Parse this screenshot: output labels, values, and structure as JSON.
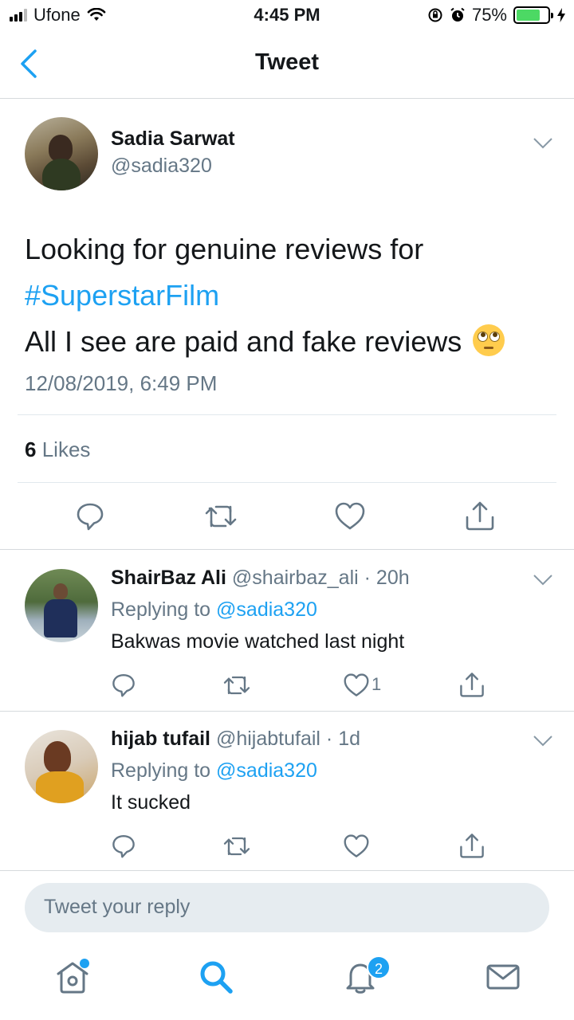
{
  "status_bar": {
    "carrier": "Ufone",
    "time": "4:45 PM",
    "battery": "75%",
    "battery_level": 0.75,
    "icons": [
      "signal-icon",
      "wifi-icon",
      "orientation-lock-icon",
      "alarm-icon",
      "battery-icon",
      "charging-icon"
    ]
  },
  "header": {
    "title": "Tweet",
    "back_icon": "chevron-left-icon"
  },
  "tweet": {
    "author_name": "Sadia Sarwat",
    "author_handle": "@sadia320",
    "text_line1": "Looking for genuine reviews for",
    "hashtag": "#SuperstarFilm",
    "text_line3": "All I see are paid and fake reviews",
    "emoji": "face-with-rolling-eyes",
    "timestamp": "12/08/2019, 6:49 PM",
    "likes_count": "6",
    "likes_label": "Likes"
  },
  "replies": [
    {
      "name": "ShairBaz Ali",
      "handle": "@shairbaz_ali",
      "time": "· 20h",
      "replying_label": "Replying to",
      "replying_to": "@sadia320",
      "text": "Bakwas movie watched last night",
      "like_count": "1"
    },
    {
      "name": "hijab tufail",
      "handle": "@hijabtufail",
      "time": "· 1d",
      "replying_label": "Replying to",
      "replying_to": "@sadia320",
      "text": "It sucked",
      "like_count": ""
    }
  ],
  "reply_box": {
    "placeholder": "Tweet your reply"
  },
  "tab_bar": {
    "items": [
      "home-icon",
      "search-icon",
      "notifications-icon",
      "messages-icon"
    ],
    "notifications_badge": "2"
  },
  "colors": {
    "accent": "#1da1f2",
    "secondary_text": "#657786",
    "primary_text": "#14171a",
    "battery_green": "#4cd964"
  }
}
